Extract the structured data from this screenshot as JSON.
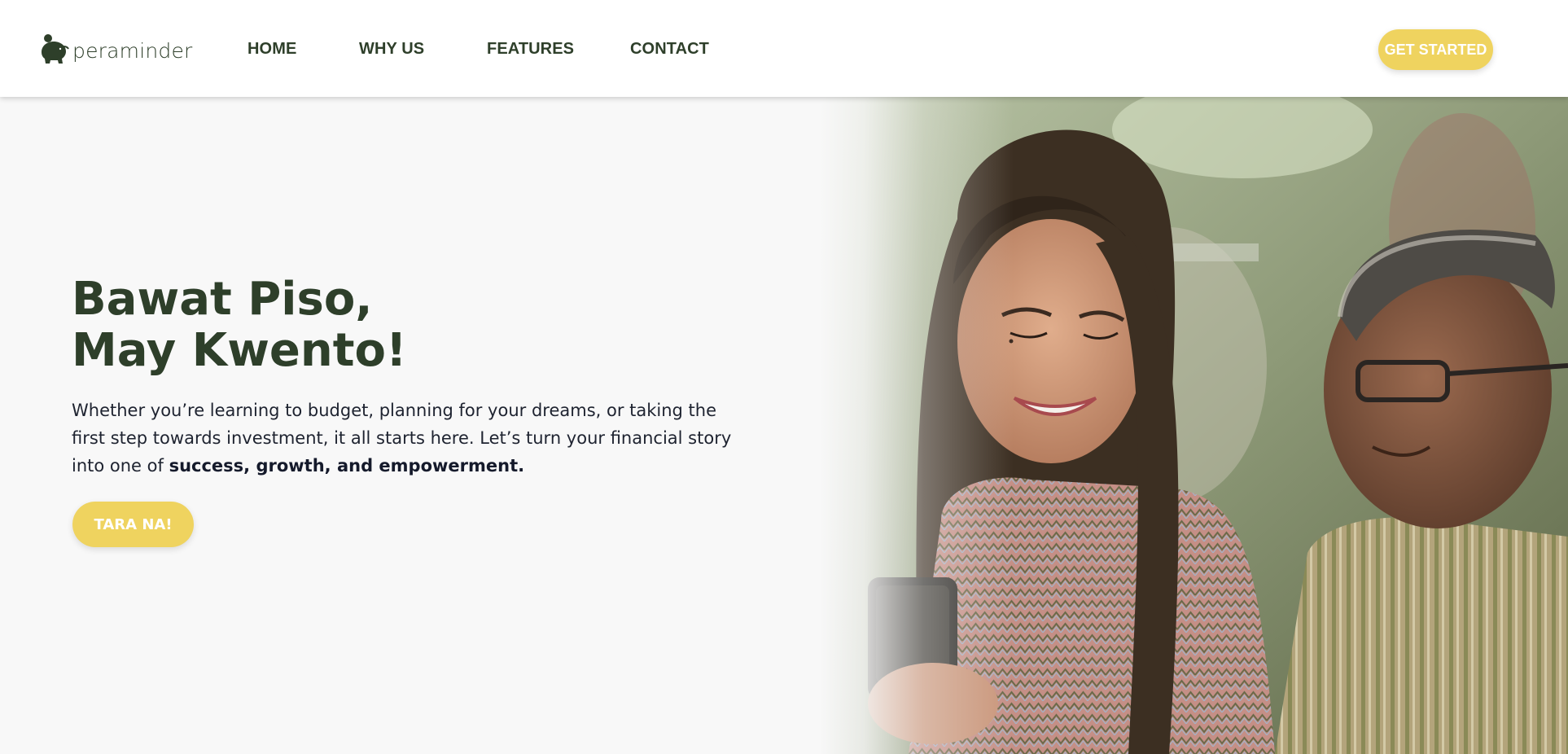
{
  "brand": {
    "name": "peraminder",
    "logo_icon": "piggy-bank-icon"
  },
  "nav": {
    "links": [
      "HOME",
      "WHY US",
      "FEATURES",
      "CONTACT"
    ],
    "cta_label": "GET STARTED"
  },
  "hero": {
    "title_line1": "Bawat Piso,",
    "title_line2": "May Kwento!",
    "description_text": "Whether you’re learning to budget, planning for your dreams, or taking the first step towards investment, it all starts here. Let’s turn your financial story into one of ",
    "description_bold": "success, growth, and empowerment.",
    "cta_label": "TARA NA!"
  },
  "colors": {
    "primary_green": "#2e3f2a",
    "accent_yellow": "#efd35f",
    "background": "#f8f8f8",
    "text_dark": "#1e2330"
  }
}
